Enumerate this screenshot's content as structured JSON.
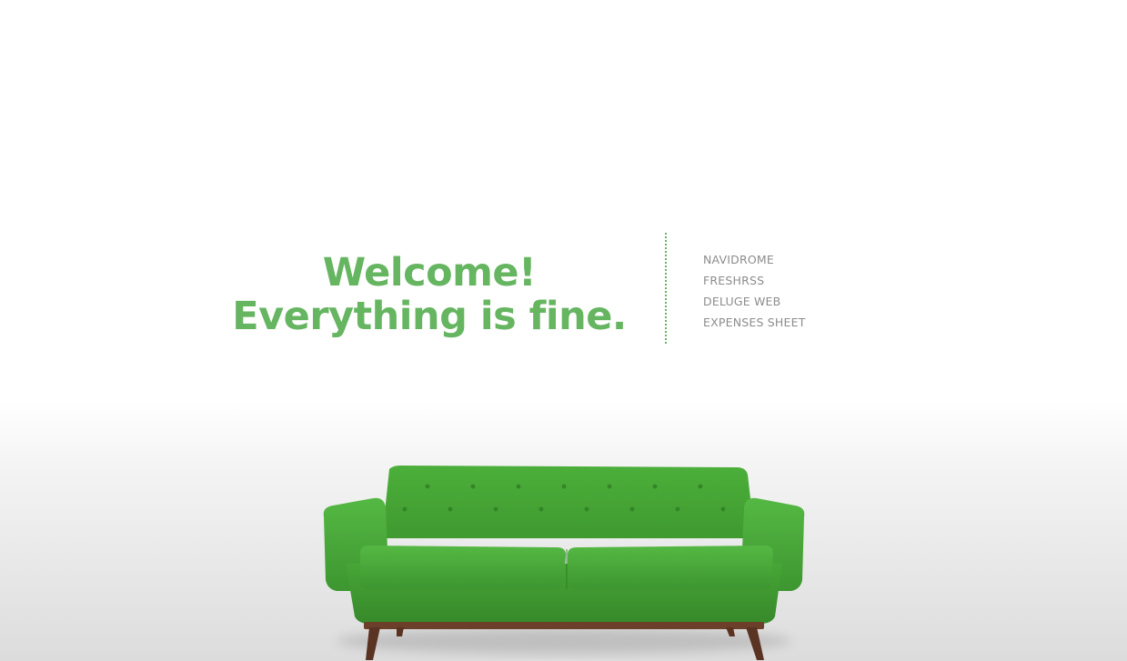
{
  "hero": {
    "line1": "Welcome!",
    "line2": "Everything is fine."
  },
  "links": [
    {
      "label": "NAVIDROME"
    },
    {
      "label": "FRESHRSS"
    },
    {
      "label": "DELUGE WEB"
    },
    {
      "label": "EXPENSES SHEET"
    }
  ],
  "colors": {
    "accent": "#66b561",
    "link": "#8c8c8c",
    "sofa": "#4caf3a",
    "legs": "#6b3f2a"
  },
  "image": {
    "subject": "green-sofa"
  }
}
